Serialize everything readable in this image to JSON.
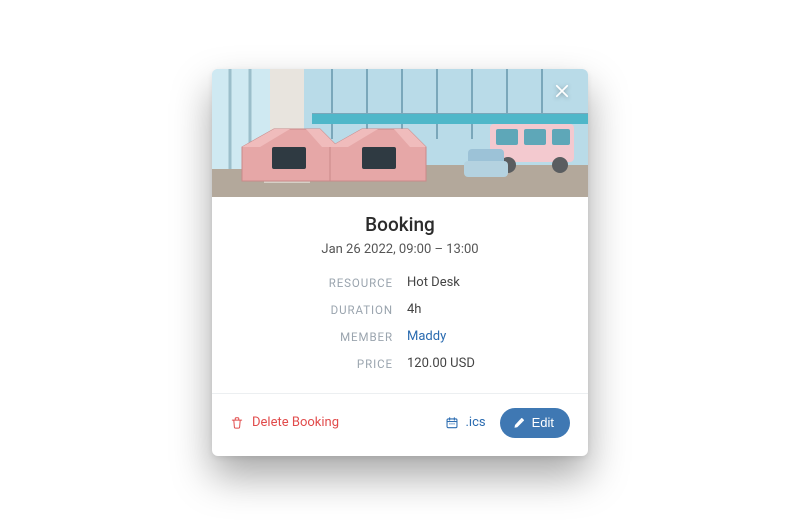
{
  "modal": {
    "title": "Booking",
    "datetime_range": "Jan 26 2022, 09:00 – 13:00",
    "fields": {
      "resource": {
        "label": "RESOURCE",
        "value": "Hot Desk"
      },
      "duration": {
        "label": "DURATION",
        "value": "4h"
      },
      "member": {
        "label": "MEMBER",
        "value": "Maddy"
      },
      "price": {
        "label": "PRICE",
        "value": "120.00 USD"
      }
    },
    "actions": {
      "delete": "Delete Booking",
      "ics": ".ics",
      "edit": "Edit"
    }
  },
  "colors": {
    "accent": "#3f78b3",
    "danger": "#e14b4b",
    "link": "#2a6bb0"
  }
}
